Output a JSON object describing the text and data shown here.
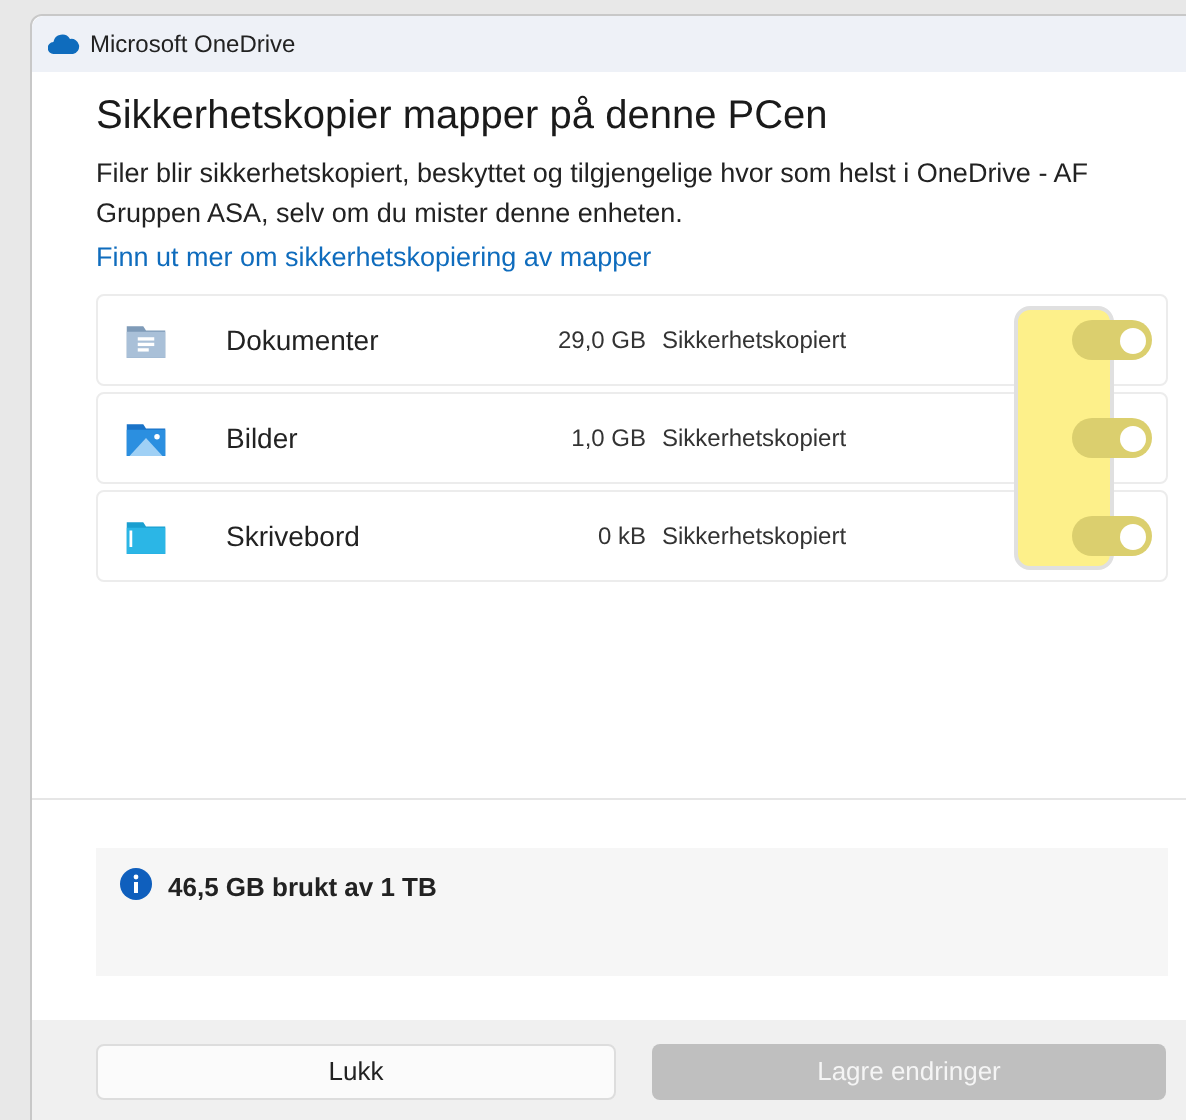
{
  "window": {
    "title": "Microsoft OneDrive"
  },
  "heading": "Sikkerhetskopier mapper på denne PCen",
  "description": "Filer blir sikkerhetskopiert, beskyttet og tilgjengelige hvor som helst i OneDrive - AF Gruppen ASA, selv om du mister denne enheten.",
  "link": "Finn ut mer om sikkerhetskopiering av mapper",
  "folders": [
    {
      "kind": "documents",
      "name": "Dokumenter",
      "size": "29,0 GB",
      "status": "Sikkerhetskopiert",
      "on": true
    },
    {
      "kind": "pictures",
      "name": "Bilder",
      "size": "1,0 GB",
      "status": "Sikkerhetskopiert",
      "on": true
    },
    {
      "kind": "desktop",
      "name": "Skrivebord",
      "size": "0 kB",
      "status": "Sikkerhetskopiert",
      "on": true
    }
  ],
  "storage": "46,5 GB brukt av 1 TB",
  "buttons": [
    {
      "label": "Lukk",
      "disabled": false
    },
    {
      "label": "Lagre endringer",
      "disabled": true
    }
  ]
}
